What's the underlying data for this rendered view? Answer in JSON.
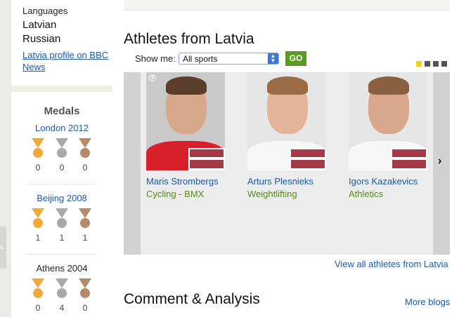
{
  "sidebar": {
    "languages_title": "Languages",
    "languages": [
      "Latvian",
      "Russian"
    ],
    "bbc_link": "Latvia profile on BBC News",
    "medals_title": "Medals",
    "games": [
      {
        "name": "London 2012",
        "gold": "0",
        "silver": "0",
        "bronze": "0"
      },
      {
        "name": "Beijing 2008",
        "gold": "1",
        "silver": "1",
        "bronze": "1"
      },
      {
        "name": "Athens 2004",
        "gold": "0",
        "silver": "4",
        "bronze": "0"
      }
    ]
  },
  "main": {
    "section_title": "Athletes from Latvia",
    "show_me_label": "Show me:",
    "sport_filter": "All sports",
    "go_label": "GO",
    "athletes": [
      {
        "name": "Maris Strombergs",
        "sport": "Cycling - BMX"
      },
      {
        "name": "Arturs Plesnieks",
        "sport": "Weightlifting"
      },
      {
        "name": "Igors Kazakevics",
        "sport": "Athletics"
      }
    ],
    "view_all": "View all athletes from Latvia",
    "comment_title": "Comment & Analysis",
    "more_blogs": "More blogs"
  },
  "colors": {
    "link": "#1a5aa6",
    "sport": "#5a8a1e",
    "gold": "#f2a93b",
    "silver": "#a9a9a9",
    "bronze": "#b48a6a",
    "go_button": "#5a9a22",
    "flag_red": "#a43a46"
  },
  "icons": {
    "carousel_next": "chevron-right-icon",
    "photo_overlay": "eye-icon",
    "sidebar_collapse": "chevron-left-icon"
  }
}
